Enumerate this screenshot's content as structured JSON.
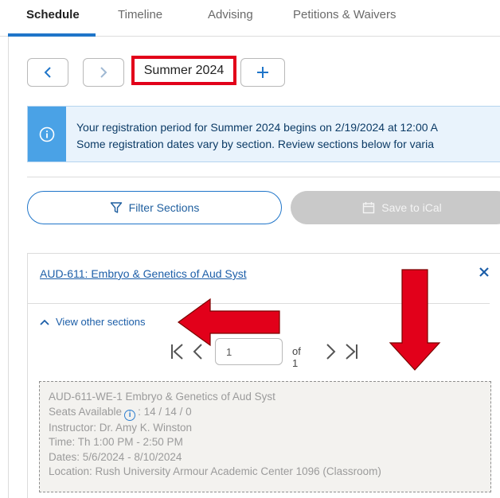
{
  "tabs": [
    {
      "label": "Schedule"
    },
    {
      "label": "Timeline"
    },
    {
      "label": "Advising"
    },
    {
      "label": "Petitions & Waivers"
    }
  ],
  "term": {
    "current": "Summer 2024"
  },
  "info": {
    "line1": "Your registration period for Summer 2024 begins on 2/19/2024 at 12:00 A",
    "line2": "Some registration dates vary by section. Review sections below for varia"
  },
  "actions": {
    "filter_label": "Filter Sections",
    "ical_label": "Save to iCal"
  },
  "course": {
    "title": "AUD-611: Embryo & Genetics of Aud Syst",
    "view_other_label": "View other sections",
    "pager": {
      "current_page": "1",
      "of_label": "of 1"
    },
    "section": {
      "name": "AUD-611-WE-1 Embryo & Genetics of Aud Syst",
      "seats_label": "Seats Available",
      "seats_value": ": 14 / 14 / 0",
      "instructor": "Instructor: Dr. Amy K. Winston",
      "time": "Time: Th 1:00 PM - 2:50 PM",
      "dates": "Dates: 5/6/2024 - 8/10/2024",
      "location": "Location: Rush University Armour Academic Center 1096 (Classroom)"
    }
  },
  "colors": {
    "accent": "#1f75c9",
    "highlight": "#e2001a",
    "info_bar": "#4aa2e6"
  }
}
